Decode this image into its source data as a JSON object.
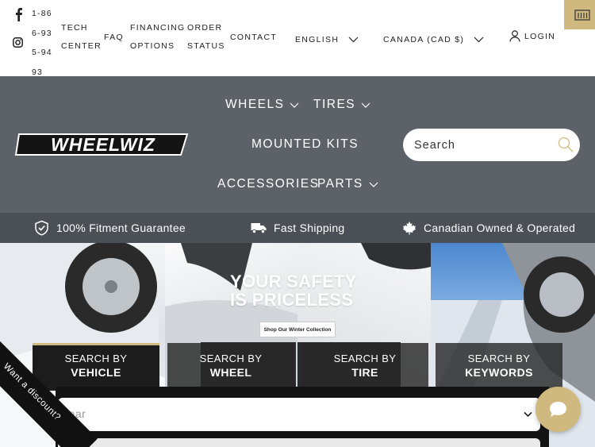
{
  "topbar": {
    "phone": "1-866-935-9493",
    "links": {
      "tech_center": "TECH CENTER",
      "faq": "FAQ",
      "financing": "FINANCING OPTIONS",
      "order_status": "ORDER STATUS",
      "contact": "CONTACT"
    },
    "language": "ENGLISH",
    "currency": "CANADA (CAD $)",
    "login": "LOGIN"
  },
  "header": {
    "logo_text": "WHEELWIZ",
    "nav": {
      "wheels": "WHEELS",
      "tires": "TIRES",
      "mounted_kits": "MOUNTED KITS",
      "accessories": "ACCESSORIES",
      "parts": "PARTS"
    },
    "search_placeholder": "Search"
  },
  "benefits": [
    {
      "label": "100% Fitment Guarantee",
      "icon": "shield-check-icon"
    },
    {
      "label": "Fast Shipping",
      "icon": "truck-icon"
    },
    {
      "label": "Canadian Owned & Operated",
      "icon": "maple-leaf-icon"
    }
  ],
  "hero": {
    "title_line1": "YOUR SAFETY",
    "title_line2": "IS PRICELESS",
    "cta": "Shop Our Winter Collection"
  },
  "search_tabs": [
    {
      "prefix": "SEARCH BY",
      "label": "VEHICLE",
      "active": true
    },
    {
      "prefix": "SEARCH BY",
      "label": "WHEEL",
      "active": false
    },
    {
      "prefix": "SEARCH BY",
      "label": "TIRE",
      "active": false
    },
    {
      "prefix": "SEARCH BY",
      "label": "KEYWORDS",
      "active": false
    }
  ],
  "vehicle_form": {
    "year_placeholder": "Year"
  },
  "discount_badge": "Want a discount?",
  "colors": {
    "accent_gold": "#cfb97f",
    "header_gray": "#5c6268",
    "strip_gray": "#4a5056",
    "panel_black": "#141414"
  }
}
